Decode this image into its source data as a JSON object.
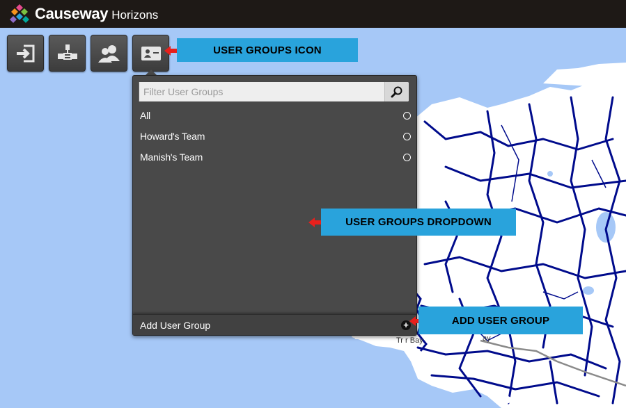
{
  "app": {
    "brand": "Causeway",
    "product": "Horizons"
  },
  "toolbar": {
    "buttons": [
      {
        "name": "login-icon"
      },
      {
        "name": "network-icon"
      },
      {
        "name": "users-icon"
      },
      {
        "name": "user-groups-icon"
      }
    ]
  },
  "dropdown": {
    "filter_placeholder": "Filter User Groups",
    "groups": [
      {
        "label": "All"
      },
      {
        "label": "Howard's Team"
      },
      {
        "label": "Manish's Team"
      }
    ],
    "footer_label": "Add User Group"
  },
  "callouts": {
    "icon": "USER GROUPS ICON",
    "dropdown": "USER GROUPS DROPDOWN",
    "add": "ADD USER GROUP"
  },
  "map_labels": {
    "bay": "Tr    r Bay",
    "bay2": "ay"
  },
  "colors": {
    "header_bg": "#1e1916",
    "sea": "#a6c8f7",
    "land": "#ffffff",
    "roads": "#000b8c",
    "callout": "#29a3dc",
    "arrow": "#e8201c",
    "panel": "#494949"
  }
}
